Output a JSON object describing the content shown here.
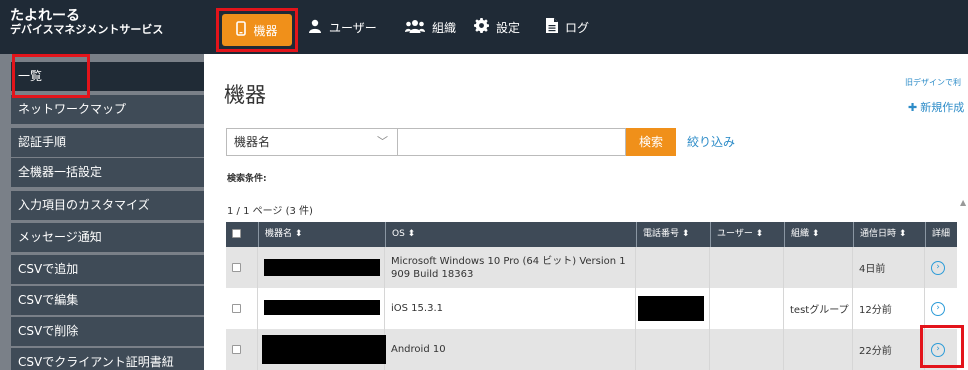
{
  "brand": {
    "line1": "たよれーる",
    "line2": "デバイスマネジメントサービス"
  },
  "nav": {
    "devices": "機器",
    "users": "ユーザー",
    "orgs": "組織",
    "settings": "設定",
    "log": "ログ"
  },
  "sidebar": {
    "items": [
      {
        "label": "一覧"
      },
      {
        "label": "ネットワークマップ"
      },
      {
        "label": "認証手順"
      },
      {
        "label": "全機器一括設定"
      },
      {
        "label": "入力項目のカスタマイズ"
      },
      {
        "label": "メッセージ通知"
      },
      {
        "label": "CSVで追加"
      },
      {
        "label": "CSVで編集"
      },
      {
        "label": "CSVで削除"
      },
      {
        "label": "CSVでクライアント証明書紐"
      }
    ]
  },
  "main": {
    "title": "機器",
    "old_design": "旧デザインで利",
    "new_create": "新規作成",
    "search": {
      "field": "機器名",
      "button": "検索",
      "narrow": "絞り込み"
    },
    "conditions_label": "検索条件:",
    "pagination": "1 / 1 ページ (3 件)"
  },
  "table": {
    "headers": {
      "name": "機器名 ⬍",
      "os": "OS ⬍",
      "phone": "電話番号 ⬍",
      "user": "ユーザー ⬍",
      "org": "組織 ⬍",
      "comm": "通信日時 ⬍",
      "detail": "詳細"
    },
    "rows": [
      {
        "name": "",
        "os": "Microsoft Windows 10 Pro (64 ビット) Version 1 909 Build 18363",
        "phone": "",
        "user": "",
        "org": "",
        "comm": "4日前"
      },
      {
        "name": "",
        "os": "iOS 15.3.1",
        "phone": "",
        "user": "",
        "org": "testグループ",
        "comm": "12分前"
      },
      {
        "name": "",
        "os": "Android 10",
        "phone": "",
        "user": "",
        "org": "",
        "comm": "22分前"
      }
    ]
  },
  "colors": {
    "accent": "#f0901a",
    "nav_bg": "#1f2a36",
    "highlight": "#e3141b",
    "link": "#2d8cc8"
  }
}
